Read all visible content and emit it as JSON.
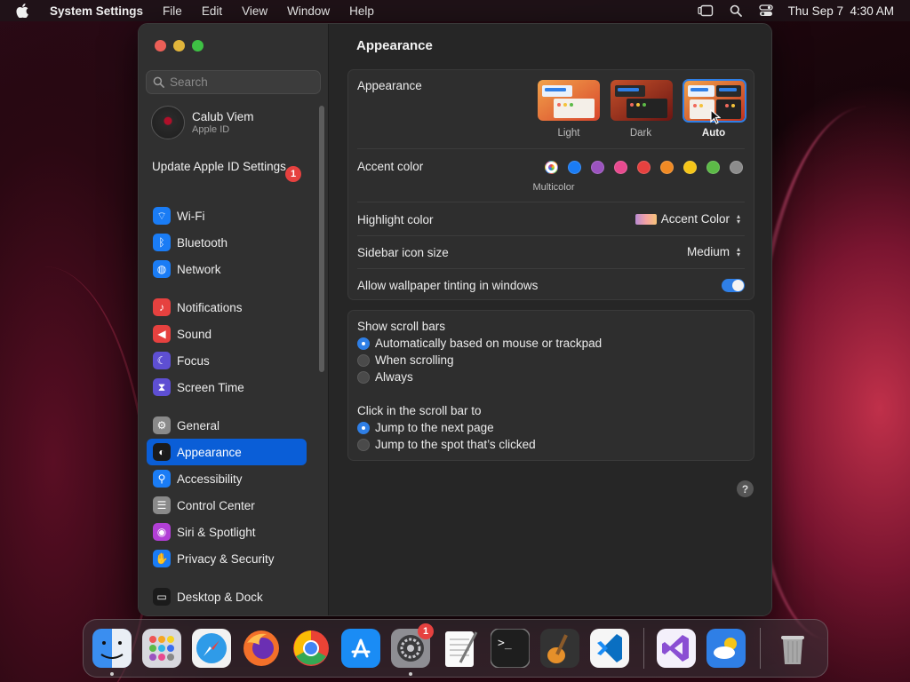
{
  "menubar": {
    "app_name": "System Settings",
    "menus": [
      "File",
      "Edit",
      "View",
      "Window",
      "Help"
    ],
    "clock": "Thu Sep 7  4:30 AM"
  },
  "sidebar": {
    "search_placeholder": "Search",
    "account": {
      "name": "Calub Viem",
      "subtitle": "Apple ID"
    },
    "update": {
      "label": "Update Apple ID Settings",
      "badge": "1"
    },
    "groups": [
      [
        {
          "label": "Wi-Fi",
          "icon": "wifi-icon",
          "color": "#1a7cf5"
        },
        {
          "label": "Bluetooth",
          "icon": "bluetooth-icon",
          "color": "#1a7cf5"
        },
        {
          "label": "Network",
          "icon": "globe-icon",
          "color": "#1a7cf5"
        }
      ],
      [
        {
          "label": "Notifications",
          "icon": "bell-icon",
          "color": "#e6413f"
        },
        {
          "label": "Sound",
          "icon": "speaker-icon",
          "color": "#e6413f"
        },
        {
          "label": "Focus",
          "icon": "moon-icon",
          "color": "#5e4fd3"
        },
        {
          "label": "Screen Time",
          "icon": "hourglass-icon",
          "color": "#5e4fd3"
        }
      ],
      [
        {
          "label": "General",
          "icon": "gear-icon",
          "color": "#8a8a8a"
        },
        {
          "label": "Appearance",
          "icon": "appearance-icon",
          "color": "#1b1b1b",
          "active": true
        },
        {
          "label": "Accessibility",
          "icon": "accessibility-icon",
          "color": "#1a7cf5"
        },
        {
          "label": "Control Center",
          "icon": "control-center-icon",
          "color": "#8a8a8a"
        },
        {
          "label": "Siri & Spotlight",
          "icon": "siri-icon",
          "color": "#b13fd6"
        },
        {
          "label": "Privacy & Security",
          "icon": "hand-icon",
          "color": "#1a7cf5"
        }
      ],
      [
        {
          "label": "Desktop & Dock",
          "icon": "dock-icon",
          "color": "#1b1b1b"
        }
      ]
    ]
  },
  "content": {
    "title": "Appearance",
    "appearance": {
      "label": "Appearance",
      "options": [
        {
          "label": "Light",
          "selected": false
        },
        {
          "label": "Dark",
          "selected": false
        },
        {
          "label": "Auto",
          "selected": true
        }
      ]
    },
    "accent": {
      "label": "Accent color",
      "selected_label": "Multicolor",
      "colors": [
        "multicolor",
        "#1a7cf5",
        "#9b53bf",
        "#e84a8f",
        "#e6413f",
        "#f08a24",
        "#f5c518",
        "#5cba47",
        "#8c8c8c"
      ]
    },
    "highlight": {
      "label": "Highlight color",
      "value": "Accent Color"
    },
    "icon_size": {
      "label": "Sidebar icon size",
      "value": "Medium"
    },
    "tinting": {
      "label": "Allow wallpaper tinting in windows",
      "on": true
    },
    "scroll_bars": {
      "label": "Show scroll bars",
      "options": [
        {
          "label": "Automatically based on mouse or trackpad",
          "selected": true
        },
        {
          "label": "When scrolling",
          "selected": false
        },
        {
          "label": "Always",
          "selected": false
        }
      ]
    },
    "click_scroll": {
      "label": "Click in the scroll bar to",
      "options": [
        {
          "label": "Jump to the next page",
          "selected": true
        },
        {
          "label": "Jump to the spot that’s clicked",
          "selected": false
        }
      ]
    },
    "help": "?"
  },
  "dock": {
    "apps": [
      {
        "name": "finder",
        "running": true
      },
      {
        "name": "launchpad"
      },
      {
        "name": "safari"
      },
      {
        "name": "firefox"
      },
      {
        "name": "chrome"
      },
      {
        "name": "app-store"
      },
      {
        "name": "system-settings",
        "running": true,
        "badge": "1"
      },
      {
        "name": "textedit"
      },
      {
        "name": "terminal"
      },
      {
        "name": "garageband"
      },
      {
        "name": "vscode"
      }
    ],
    "recent": [
      {
        "name": "visual-studio"
      },
      {
        "name": "weather"
      }
    ],
    "trash": {
      "name": "trash"
    }
  }
}
